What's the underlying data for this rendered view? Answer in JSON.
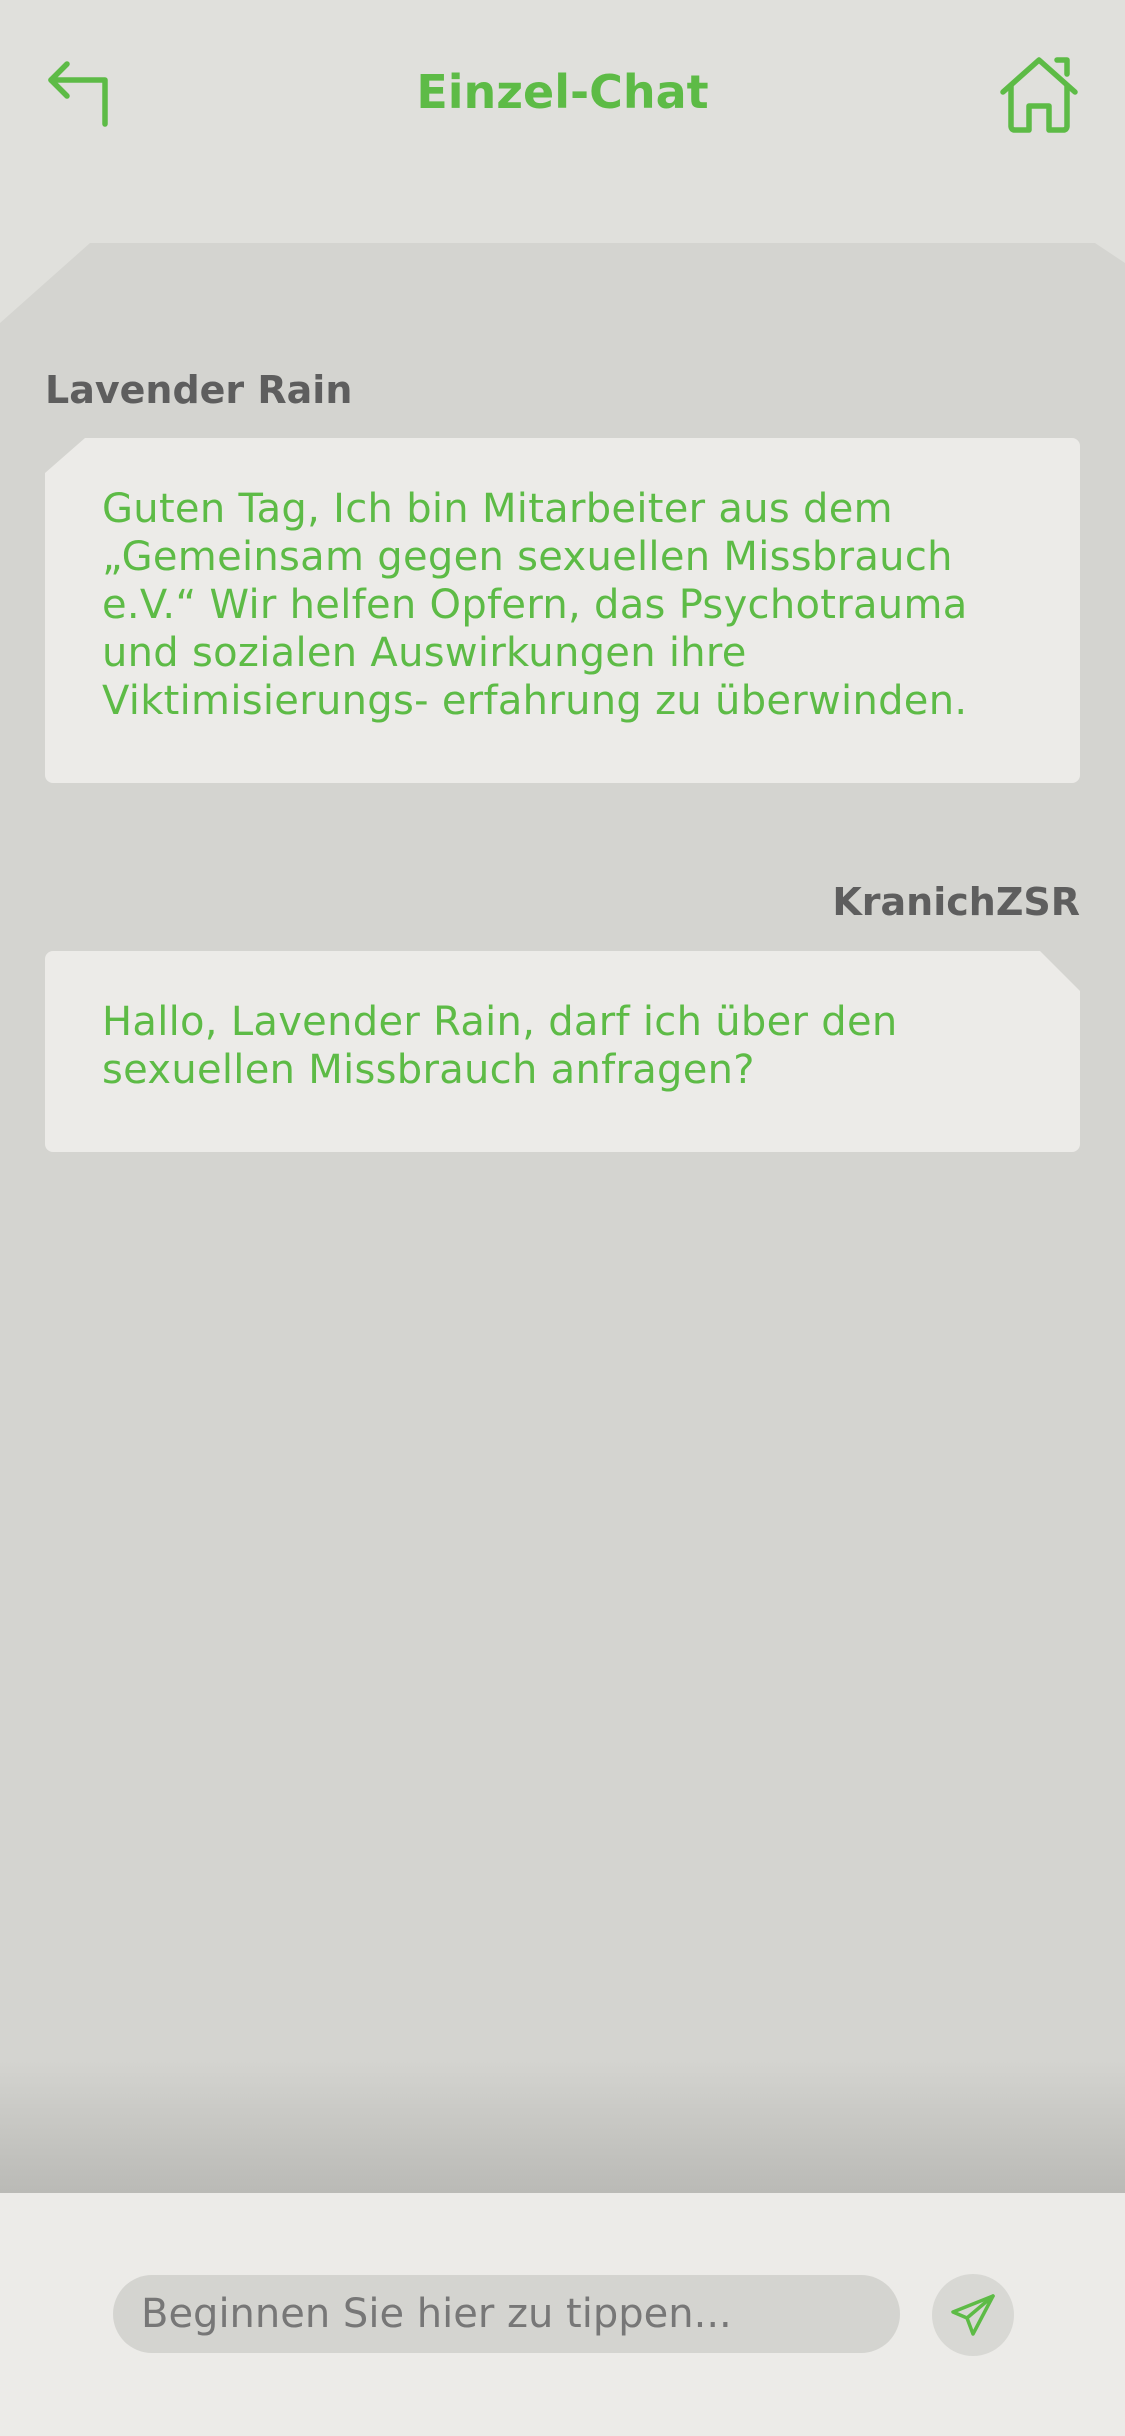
{
  "header": {
    "title": "Einzel-Chat",
    "back_icon": "back-arrow-icon",
    "home_icon": "home-icon"
  },
  "messages": [
    {
      "sender": "Lavender Rain",
      "side": "left",
      "text": "Guten Tag, Ich bin Mitarbeiter aus dem „Gemeinsam gegen sexuellen Missbrauch e.V.“ Wir helfen Opfern, das Psychotrauma und sozialen Auswirkungen ihre Viktimisierungs- erfahrung zu überwinden."
    },
    {
      "sender": "KranichZSR",
      "side": "right",
      "text": "Hallo, Lavender Rain, darf ich über den sexuellen Missbrauch anfragen?"
    }
  ],
  "composer": {
    "placeholder": "Beginnen Sie hier zu tippen...",
    "value": "",
    "send_icon": "paper-plane-icon"
  },
  "colors": {
    "accent": "#5dbb46",
    "background": "#e0e0dc",
    "panel": "#d4d4d0",
    "bubble": "#ecebe8",
    "sender_text": "#5e5e5e"
  }
}
